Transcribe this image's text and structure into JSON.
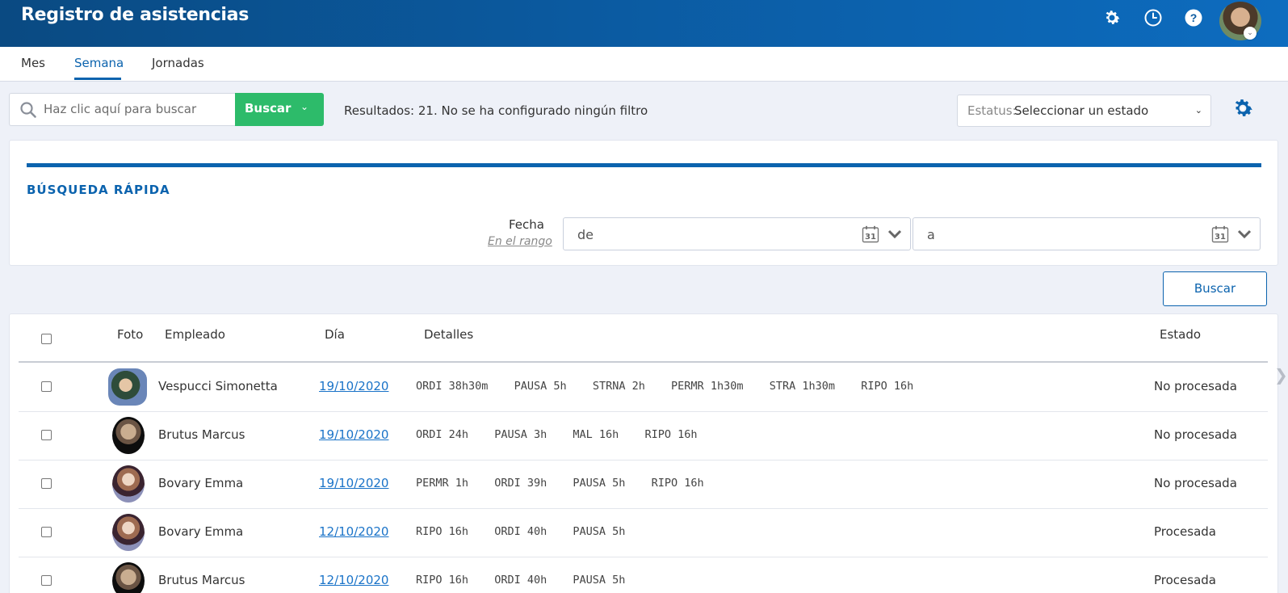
{
  "header": {
    "title": "Registro de asistencias",
    "icons": [
      "gear-icon",
      "clock-icon",
      "help-icon"
    ]
  },
  "tabs": [
    {
      "label": "Mes",
      "active": false
    },
    {
      "label": "Semana",
      "active": true
    },
    {
      "label": "Jornadas",
      "active": false
    }
  ],
  "search": {
    "placeholder": "Haz clic aquí para buscar",
    "button_label": "Buscar",
    "results_text": "Resultados: 21. No se ha configurado ningún filtro"
  },
  "status_filter": {
    "label": "Estatus:",
    "value": "Seleccionar un estado"
  },
  "quick_search": {
    "title": "BÚSQUEDA RÁPIDA",
    "date_label": "Fecha",
    "range_label": "En el rango",
    "from_placeholder": "de",
    "to_placeholder": "a",
    "calendar_day": "31",
    "button_label": "Buscar"
  },
  "table": {
    "columns": {
      "photo": "Foto",
      "employee": "Empleado",
      "day": "Día",
      "details": "Detalles",
      "status": "Estado"
    },
    "rows": [
      {
        "employee": "Vespucci Simonetta",
        "day": "19/10/2020",
        "details": [
          "ORDI 38h30m",
          "PAUSA 5h",
          "STRNA 2h",
          "PERMR 1h30m",
          "STRA 1h30m",
          "RIPO 16h"
        ],
        "status": "No procesada"
      },
      {
        "employee": "Brutus Marcus",
        "day": "19/10/2020",
        "details": [
          "ORDI 24h",
          "PAUSA 3h",
          "MAL 16h",
          "RIPO 16h"
        ],
        "status": "No procesada"
      },
      {
        "employee": "Bovary Emma",
        "day": "19/10/2020",
        "details": [
          "PERMR 1h",
          "ORDI 39h",
          "PAUSA 5h",
          "RIPO 16h"
        ],
        "status": "No procesada"
      },
      {
        "employee": "Bovary Emma",
        "day": "12/10/2020",
        "details": [
          "RIPO 16h",
          "ORDI 40h",
          "PAUSA 5h"
        ],
        "status": "Procesada"
      },
      {
        "employee": "Brutus Marcus",
        "day": "12/10/2020",
        "details": [
          "RIPO 16h",
          "ORDI 40h",
          "PAUSA 5h"
        ],
        "status": "Procesada"
      }
    ]
  },
  "colors": {
    "header_bg": "#0b5aa0",
    "accent": "#0b63ae",
    "green_button": "#2dbb6a",
    "link": "#1a73c8"
  }
}
